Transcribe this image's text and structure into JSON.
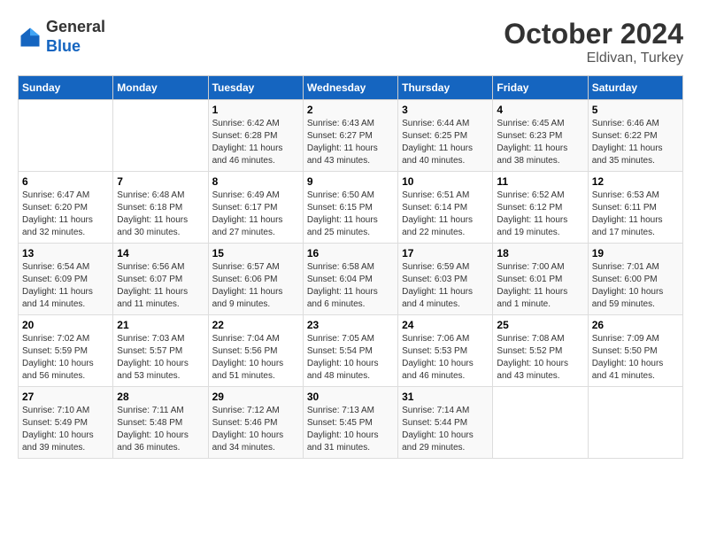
{
  "header": {
    "logo_line1": "General",
    "logo_line2": "Blue",
    "month": "October 2024",
    "location": "Eldivan, Turkey"
  },
  "days_of_week": [
    "Sunday",
    "Monday",
    "Tuesday",
    "Wednesday",
    "Thursday",
    "Friday",
    "Saturday"
  ],
  "weeks": [
    [
      {
        "day": "",
        "sunrise": "",
        "sunset": "",
        "daylight": ""
      },
      {
        "day": "",
        "sunrise": "",
        "sunset": "",
        "daylight": ""
      },
      {
        "day": "1",
        "sunrise": "Sunrise: 6:42 AM",
        "sunset": "Sunset: 6:28 PM",
        "daylight": "Daylight: 11 hours and 46 minutes."
      },
      {
        "day": "2",
        "sunrise": "Sunrise: 6:43 AM",
        "sunset": "Sunset: 6:27 PM",
        "daylight": "Daylight: 11 hours and 43 minutes."
      },
      {
        "day": "3",
        "sunrise": "Sunrise: 6:44 AM",
        "sunset": "Sunset: 6:25 PM",
        "daylight": "Daylight: 11 hours and 40 minutes."
      },
      {
        "day": "4",
        "sunrise": "Sunrise: 6:45 AM",
        "sunset": "Sunset: 6:23 PM",
        "daylight": "Daylight: 11 hours and 38 minutes."
      },
      {
        "day": "5",
        "sunrise": "Sunrise: 6:46 AM",
        "sunset": "Sunset: 6:22 PM",
        "daylight": "Daylight: 11 hours and 35 minutes."
      }
    ],
    [
      {
        "day": "6",
        "sunrise": "Sunrise: 6:47 AM",
        "sunset": "Sunset: 6:20 PM",
        "daylight": "Daylight: 11 hours and 32 minutes."
      },
      {
        "day": "7",
        "sunrise": "Sunrise: 6:48 AM",
        "sunset": "Sunset: 6:18 PM",
        "daylight": "Daylight: 11 hours and 30 minutes."
      },
      {
        "day": "8",
        "sunrise": "Sunrise: 6:49 AM",
        "sunset": "Sunset: 6:17 PM",
        "daylight": "Daylight: 11 hours and 27 minutes."
      },
      {
        "day": "9",
        "sunrise": "Sunrise: 6:50 AM",
        "sunset": "Sunset: 6:15 PM",
        "daylight": "Daylight: 11 hours and 25 minutes."
      },
      {
        "day": "10",
        "sunrise": "Sunrise: 6:51 AM",
        "sunset": "Sunset: 6:14 PM",
        "daylight": "Daylight: 11 hours and 22 minutes."
      },
      {
        "day": "11",
        "sunrise": "Sunrise: 6:52 AM",
        "sunset": "Sunset: 6:12 PM",
        "daylight": "Daylight: 11 hours and 19 minutes."
      },
      {
        "day": "12",
        "sunrise": "Sunrise: 6:53 AM",
        "sunset": "Sunset: 6:11 PM",
        "daylight": "Daylight: 11 hours and 17 minutes."
      }
    ],
    [
      {
        "day": "13",
        "sunrise": "Sunrise: 6:54 AM",
        "sunset": "Sunset: 6:09 PM",
        "daylight": "Daylight: 11 hours and 14 minutes."
      },
      {
        "day": "14",
        "sunrise": "Sunrise: 6:56 AM",
        "sunset": "Sunset: 6:07 PM",
        "daylight": "Daylight: 11 hours and 11 minutes."
      },
      {
        "day": "15",
        "sunrise": "Sunrise: 6:57 AM",
        "sunset": "Sunset: 6:06 PM",
        "daylight": "Daylight: 11 hours and 9 minutes."
      },
      {
        "day": "16",
        "sunrise": "Sunrise: 6:58 AM",
        "sunset": "Sunset: 6:04 PM",
        "daylight": "Daylight: 11 hours and 6 minutes."
      },
      {
        "day": "17",
        "sunrise": "Sunrise: 6:59 AM",
        "sunset": "Sunset: 6:03 PM",
        "daylight": "Daylight: 11 hours and 4 minutes."
      },
      {
        "day": "18",
        "sunrise": "Sunrise: 7:00 AM",
        "sunset": "Sunset: 6:01 PM",
        "daylight": "Daylight: 11 hours and 1 minute."
      },
      {
        "day": "19",
        "sunrise": "Sunrise: 7:01 AM",
        "sunset": "Sunset: 6:00 PM",
        "daylight": "Daylight: 10 hours and 59 minutes."
      }
    ],
    [
      {
        "day": "20",
        "sunrise": "Sunrise: 7:02 AM",
        "sunset": "Sunset: 5:59 PM",
        "daylight": "Daylight: 10 hours and 56 minutes."
      },
      {
        "day": "21",
        "sunrise": "Sunrise: 7:03 AM",
        "sunset": "Sunset: 5:57 PM",
        "daylight": "Daylight: 10 hours and 53 minutes."
      },
      {
        "day": "22",
        "sunrise": "Sunrise: 7:04 AM",
        "sunset": "Sunset: 5:56 PM",
        "daylight": "Daylight: 10 hours and 51 minutes."
      },
      {
        "day": "23",
        "sunrise": "Sunrise: 7:05 AM",
        "sunset": "Sunset: 5:54 PM",
        "daylight": "Daylight: 10 hours and 48 minutes."
      },
      {
        "day": "24",
        "sunrise": "Sunrise: 7:06 AM",
        "sunset": "Sunset: 5:53 PM",
        "daylight": "Daylight: 10 hours and 46 minutes."
      },
      {
        "day": "25",
        "sunrise": "Sunrise: 7:08 AM",
        "sunset": "Sunset: 5:52 PM",
        "daylight": "Daylight: 10 hours and 43 minutes."
      },
      {
        "day": "26",
        "sunrise": "Sunrise: 7:09 AM",
        "sunset": "Sunset: 5:50 PM",
        "daylight": "Daylight: 10 hours and 41 minutes."
      }
    ],
    [
      {
        "day": "27",
        "sunrise": "Sunrise: 7:10 AM",
        "sunset": "Sunset: 5:49 PM",
        "daylight": "Daylight: 10 hours and 39 minutes."
      },
      {
        "day": "28",
        "sunrise": "Sunrise: 7:11 AM",
        "sunset": "Sunset: 5:48 PM",
        "daylight": "Daylight: 10 hours and 36 minutes."
      },
      {
        "day": "29",
        "sunrise": "Sunrise: 7:12 AM",
        "sunset": "Sunset: 5:46 PM",
        "daylight": "Daylight: 10 hours and 34 minutes."
      },
      {
        "day": "30",
        "sunrise": "Sunrise: 7:13 AM",
        "sunset": "Sunset: 5:45 PM",
        "daylight": "Daylight: 10 hours and 31 minutes."
      },
      {
        "day": "31",
        "sunrise": "Sunrise: 7:14 AM",
        "sunset": "Sunset: 5:44 PM",
        "daylight": "Daylight: 10 hours and 29 minutes."
      },
      {
        "day": "",
        "sunrise": "",
        "sunset": "",
        "daylight": ""
      },
      {
        "day": "",
        "sunrise": "",
        "sunset": "",
        "daylight": ""
      }
    ]
  ]
}
